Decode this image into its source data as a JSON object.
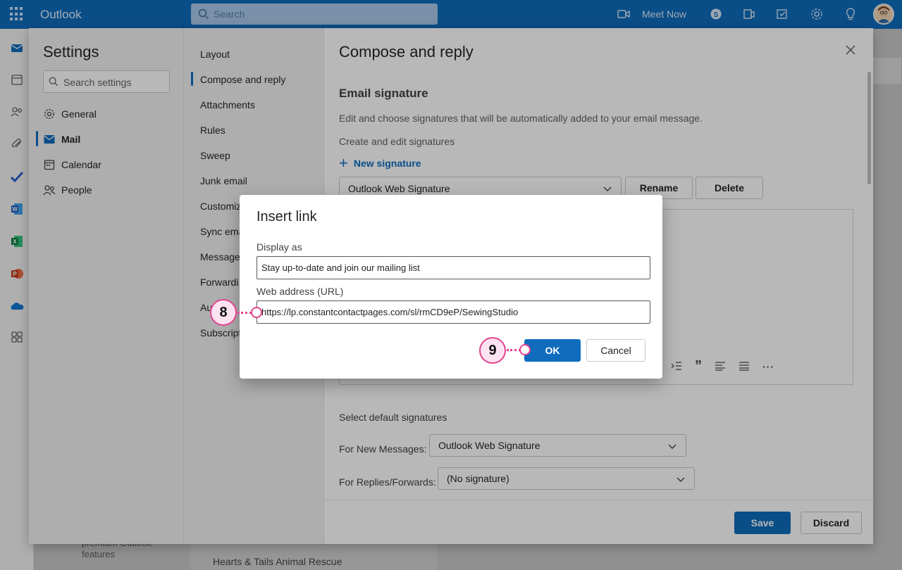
{
  "topbar": {
    "app_name": "Outlook",
    "search_placeholder": "Search",
    "meet_now": "Meet Now"
  },
  "background": {
    "promo_line1": "premium Outlook",
    "promo_line2": "features",
    "list_item": "Hearts & Tails Animal Rescue"
  },
  "settings": {
    "title": "Settings",
    "search_placeholder": "Search settings",
    "categories": [
      {
        "label": "General",
        "icon": "gear-icon"
      },
      {
        "label": "Mail",
        "icon": "mail-icon"
      },
      {
        "label": "Calendar",
        "icon": "calendar-icon"
      },
      {
        "label": "People",
        "icon": "people-icon"
      }
    ],
    "subcategories": [
      "Layout",
      "Compose and reply",
      "Attachments",
      "Rules",
      "Sweep",
      "Junk email",
      "Customiz",
      "Sync emai",
      "Message",
      "Forwardi",
      "Au",
      "Subscript"
    ]
  },
  "pane": {
    "title": "Compose and reply",
    "section": "Email signature",
    "description": "Edit and choose signatures that will be automatically added to your email message.",
    "create_edit": "Create and edit signatures",
    "new_signature": "New signature",
    "selected_signature": "Outlook Web Signature",
    "rename": "Rename",
    "delete": "Delete",
    "default_label": "Select default signatures",
    "new_messages_label": "For New Messages:",
    "new_messages_value": "Outlook Web Signature",
    "replies_label": "For Replies/Forwards:",
    "replies_value": "(No signature)",
    "save": "Save",
    "discard": "Discard",
    "toolbar_quote": "”",
    "toolbar_more": "···"
  },
  "dialog": {
    "title": "Insert link",
    "display_label": "Display as",
    "display_value": "Stay up-to-date and join our mailing list",
    "url_label": "Web address (URL)",
    "url_value": "https://lp.constantcontactpages.com/sl/rmCD9eP/SewingStudio",
    "ok": "OK",
    "cancel": "Cancel"
  },
  "steps": {
    "step8": "8",
    "step9": "9"
  },
  "colors": {
    "accent": "#0f6cbd",
    "callout": "#e3448f"
  }
}
